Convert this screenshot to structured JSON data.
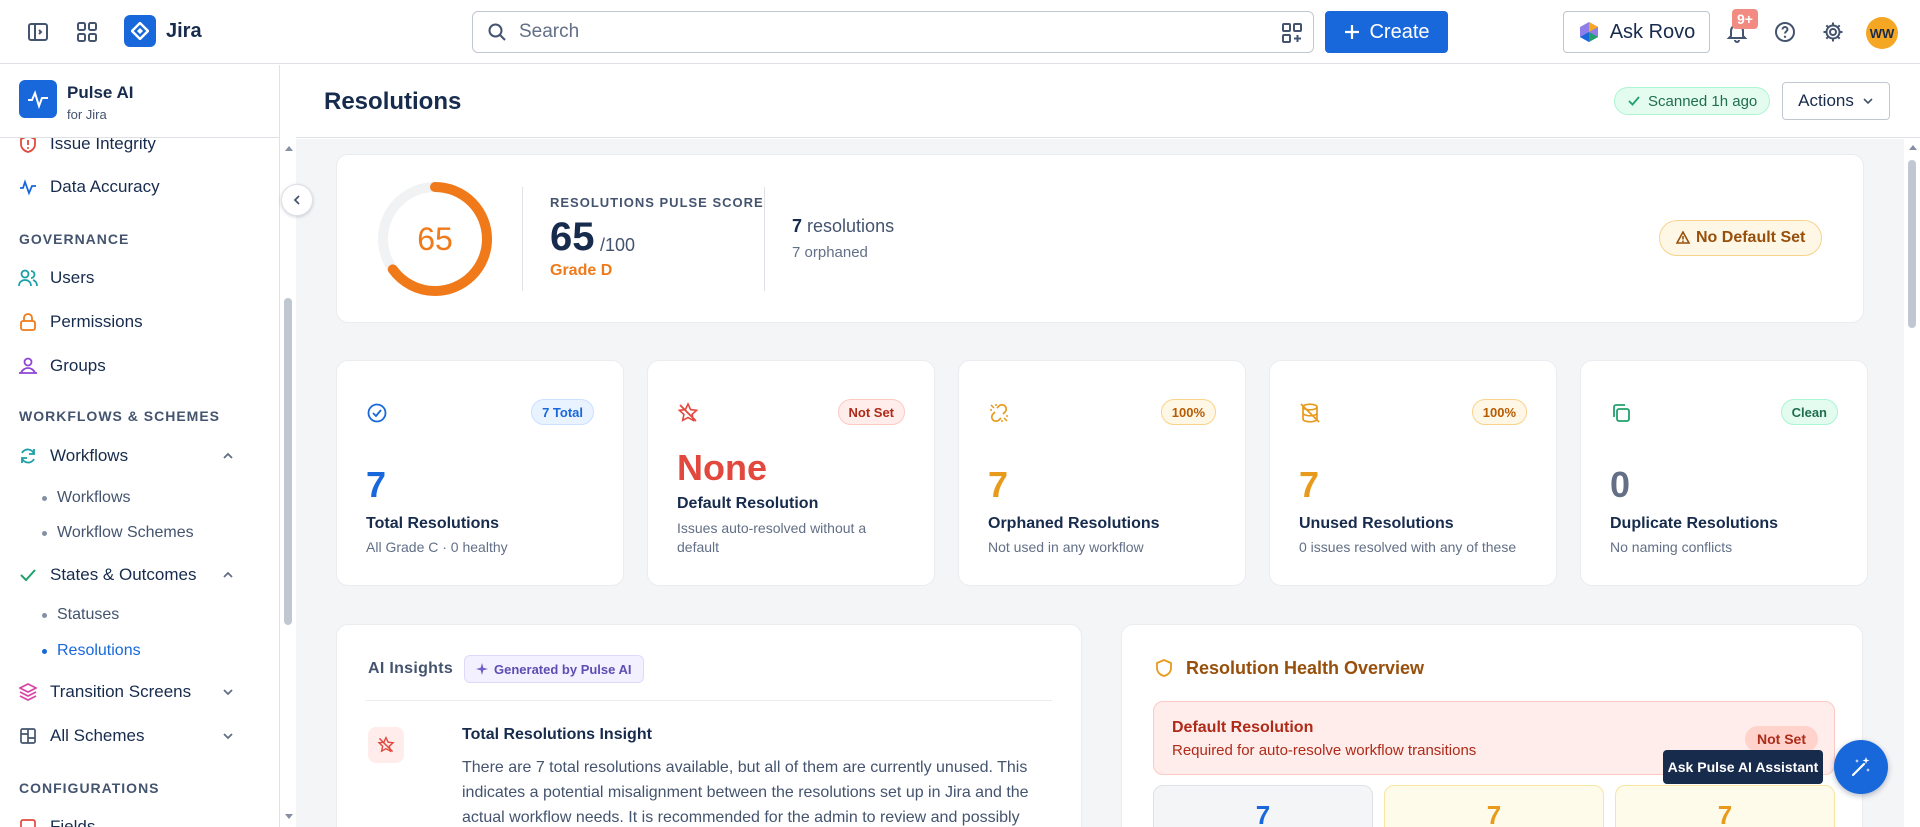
{
  "topbar": {
    "app_name": "Jira",
    "search_placeholder": "Search",
    "create_label": "Create",
    "ask_rovo_label": "Ask Rovo",
    "notifications_badge": "9+",
    "avatar_initials": "WW"
  },
  "sidebar": {
    "app_name": "Pulse AI",
    "app_sub": "for Jira",
    "items": [
      {
        "label": "Issue Integrity",
        "icon": "shield-alert-icon"
      },
      {
        "label": "Data Accuracy",
        "icon": "activity-icon"
      }
    ],
    "sections": {
      "governance": "GOVERNANCE",
      "workflows": "WORKFLOWS & SCHEMES",
      "configurations": "CONFIGURATIONS"
    },
    "governance_items": [
      {
        "label": "Users",
        "icon": "users-icon"
      },
      {
        "label": "Permissions",
        "icon": "lock-icon"
      },
      {
        "label": "Groups",
        "icon": "groups-icon"
      }
    ],
    "workflows_group": {
      "label": "Workflows",
      "sub": [
        "Workflows",
        "Workflow Schemes"
      ]
    },
    "states_group": {
      "label": "States & Outcomes",
      "sub": [
        "Statuses",
        "Resolutions"
      ]
    },
    "transition_screens": "Transition Screens",
    "all_schemes": "All Schemes",
    "fields": "Fields"
  },
  "page": {
    "title": "Resolutions",
    "scanned": "Scanned 1h ago",
    "actions": "Actions"
  },
  "score": {
    "gauge_value": 65,
    "label": "RESOLUTIONS PULSE SCORE",
    "value": "65",
    "max": "/100",
    "grade": "Grade D",
    "resolutions_count": "7",
    "resolutions_word": "resolutions",
    "orphaned": "7 orphaned",
    "no_default": "No Default Set"
  },
  "stats": [
    {
      "badge": "7 Total",
      "value": "7",
      "label": "Total Resolutions",
      "sub": "All Grade C · 0 healthy",
      "color": "#1868db",
      "icon": "check-circle-icon"
    },
    {
      "badge": "Not Set",
      "value": "None",
      "label": "Default Resolution",
      "sub": "Issues auto-resolved without a default",
      "color": "#e2483d",
      "icon": "star-off-icon"
    },
    {
      "badge": "100%",
      "value": "7",
      "label": "Orphaned Resolutions",
      "sub": "Not used in any workflow",
      "color": "#e89a1d",
      "icon": "unlink-icon"
    },
    {
      "badge": "100%",
      "value": "7",
      "label": "Unused Resolutions",
      "sub": "0 issues resolved with any of these",
      "color": "#e89a1d",
      "icon": "database-off-icon"
    },
    {
      "badge": "Clean",
      "value": "0",
      "label": "Duplicate Resolutions",
      "sub": "No naming conflicts",
      "color": "#626f86",
      "icon": "copy-icon"
    }
  ],
  "ai": {
    "title": "AI Insights",
    "badge": "Generated by Pulse AI",
    "insight_title": "Total Resolutions Insight",
    "insight_text": "There are 7 total resolutions available, but all of them are currently unused. This indicates a potential misalignment between the resolutions set up in Jira and the actual workflow needs. It is recommended for the admin to review and possibly remove or repurpose these"
  },
  "health": {
    "title": "Resolution Health Overview",
    "default_title": "Default Resolution",
    "default_sub": "Required for auto-resolve workflow transitions",
    "default_badge": "Not Set",
    "mini": [
      "7",
      "7",
      "7"
    ]
  },
  "assistant": {
    "tooltip": "Ask Pulse AI Assistant"
  }
}
